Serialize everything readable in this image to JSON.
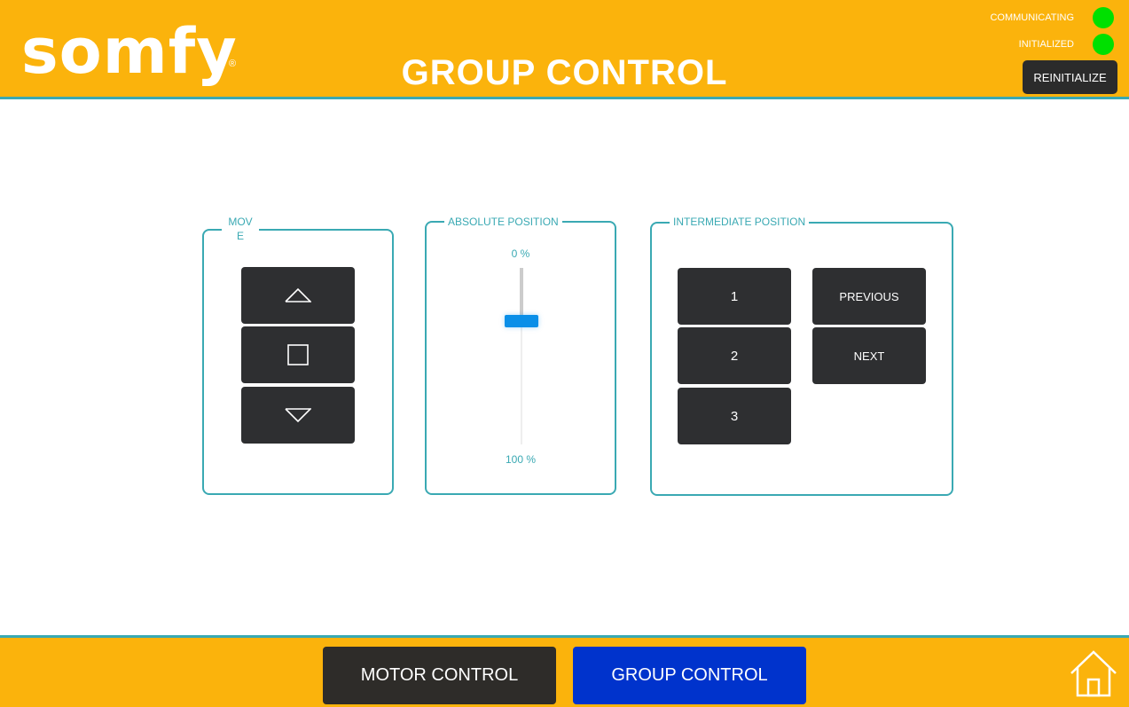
{
  "header": {
    "logo_text": "somfy",
    "logo_reg": "®",
    "title": "GROUP CONTROL",
    "status": [
      {
        "label": "COMMUNICATING",
        "color": "#00e000"
      },
      {
        "label": "INITIALIZED",
        "color": "#00e000"
      }
    ],
    "reinitialize_label": "REINITIALIZE"
  },
  "move_panel": {
    "legend_line1": "MOV",
    "legend_line2": "E",
    "buttons": [
      {
        "icon": "chevron-up-icon"
      },
      {
        "icon": "stop-square-icon"
      },
      {
        "icon": "chevron-down-icon"
      }
    ]
  },
  "absolute_position": {
    "legend": "ABSOLUTE POSITION",
    "min_label": "0 %",
    "max_label": "100 %",
    "slider_value_pct": 30
  },
  "intermediate_position": {
    "legend": "INTERMEDIATE POSITION",
    "positions": [
      "1",
      "2",
      "3"
    ],
    "previous_label": "PREVIOUS",
    "next_label": "NEXT"
  },
  "footer": {
    "motor_control_label": "MOTOR CONTROL",
    "group_control_label": "GROUP CONTROL",
    "home_icon": "home-icon"
  },
  "colors": {
    "header_bg": "#fbb30c",
    "accent": "#3aa9b3",
    "dark_button": "#2e2f31",
    "active_nav": "#0033cc",
    "slider_thumb": "#0a8fe8",
    "status_ok": "#00e000"
  }
}
